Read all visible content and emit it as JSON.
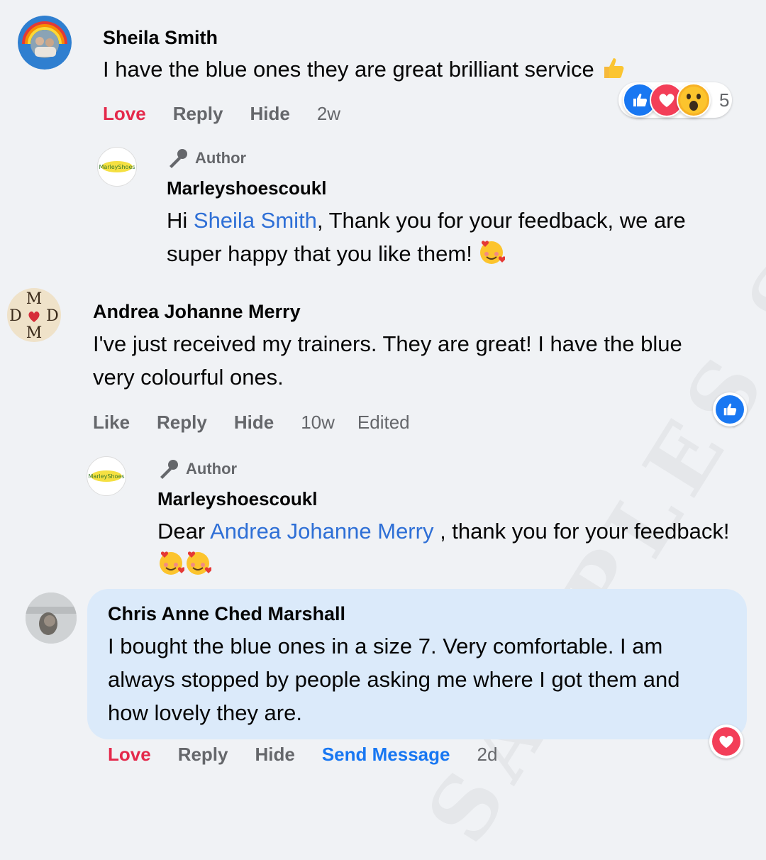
{
  "comments": [
    {
      "name": "Sheila Smith",
      "text": "I have the blue ones they are great brilliant service",
      "actions": {
        "react": "Love",
        "reply": "Reply",
        "hide": "Hide",
        "time": "2w"
      },
      "reaction_count": "5",
      "reply": {
        "tag": "Author",
        "name": "Marleyshoescoukl",
        "prefix": "Hi ",
        "mention": "Sheila Smith",
        "text": ", Thank you for your feedback, we are super happy that you like them!"
      }
    },
    {
      "name": "Andrea Johanne Merry",
      "text": "I've just received my trainers. They are great! I have the blue very colourful ones.",
      "actions": {
        "react": "Like",
        "reply": "Reply",
        "hide": "Hide",
        "time": "10w",
        "edited": "Edited"
      },
      "reply": {
        "tag": "Author",
        "name": "Marleyshoescoukl",
        "prefix": "Dear ",
        "mention": "Andrea Johanne Merry",
        "text": " , thank you for your feedback!"
      }
    },
    {
      "name": "Chris Anne Ched Marshall",
      "text": "I bought the blue ones in a size 7. Very comfortable. I am always stopped by people asking me where I got them and how lovely they are.",
      "actions": {
        "react": "Love",
        "reply": "Reply",
        "hide": "Hide",
        "message": "Send Message",
        "time": "2d"
      }
    }
  ],
  "avatar_monogram": {
    "top": "M",
    "left": "D",
    "right": "D",
    "bottom": "M"
  },
  "logo_text": "MarleyShoes",
  "watermark": "SAMPLES SHOES",
  "colors": {
    "love": "#e4294b",
    "link": "#2e6fd6",
    "like_blue": "#1877f2",
    "muted": "#65676b",
    "highlight": "#dbeafa"
  },
  "icons": [
    "thumbs-up-emoji",
    "like-reaction-icon",
    "love-reaction-icon",
    "wow-reaction-icon",
    "microphone-icon",
    "smiling-hearts-emoji",
    "heart-reaction-icon"
  ]
}
